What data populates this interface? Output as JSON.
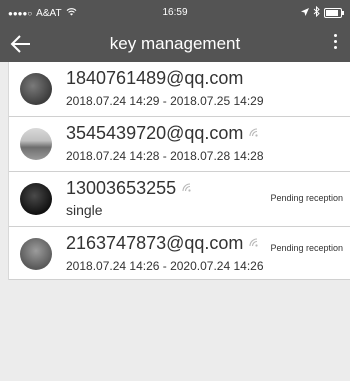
{
  "status_bar": {
    "signal_dots": "●●●●○",
    "carrier": "A&AT",
    "wifi_icon": "wifi-icon",
    "time": "16:59",
    "location_icon": "location-arrow-icon",
    "bluetooth_icon": "bluetooth-icon",
    "battery_icon": "battery-icon"
  },
  "toolbar": {
    "back_icon": "back-arrow-icon",
    "title": "key management",
    "more_icon": "more-vertical-icon"
  },
  "keys": [
    {
      "name": "1840761489@qq.com",
      "detail": "2018.07.24 14:29 - 2018.07.25 14:29",
      "status": "",
      "signal": false
    },
    {
      "name": "3545439720@qq.com",
      "detail": "2018.07.24 14:28 - 2018.07.28 14:28",
      "status": "",
      "signal": true
    },
    {
      "name": "13003653255",
      "detail": "single",
      "status": "Pending reception",
      "signal": true
    },
    {
      "name": "2163747873@qq.com",
      "detail": "2018.07.24 14:26 - 2020.07.24 14:26",
      "status": "Pending reception",
      "signal": true
    }
  ],
  "colors": {
    "header_bg": "#545454",
    "list_bg": "#ffffff",
    "empty_bg": "#ececec",
    "text": "#333333"
  }
}
